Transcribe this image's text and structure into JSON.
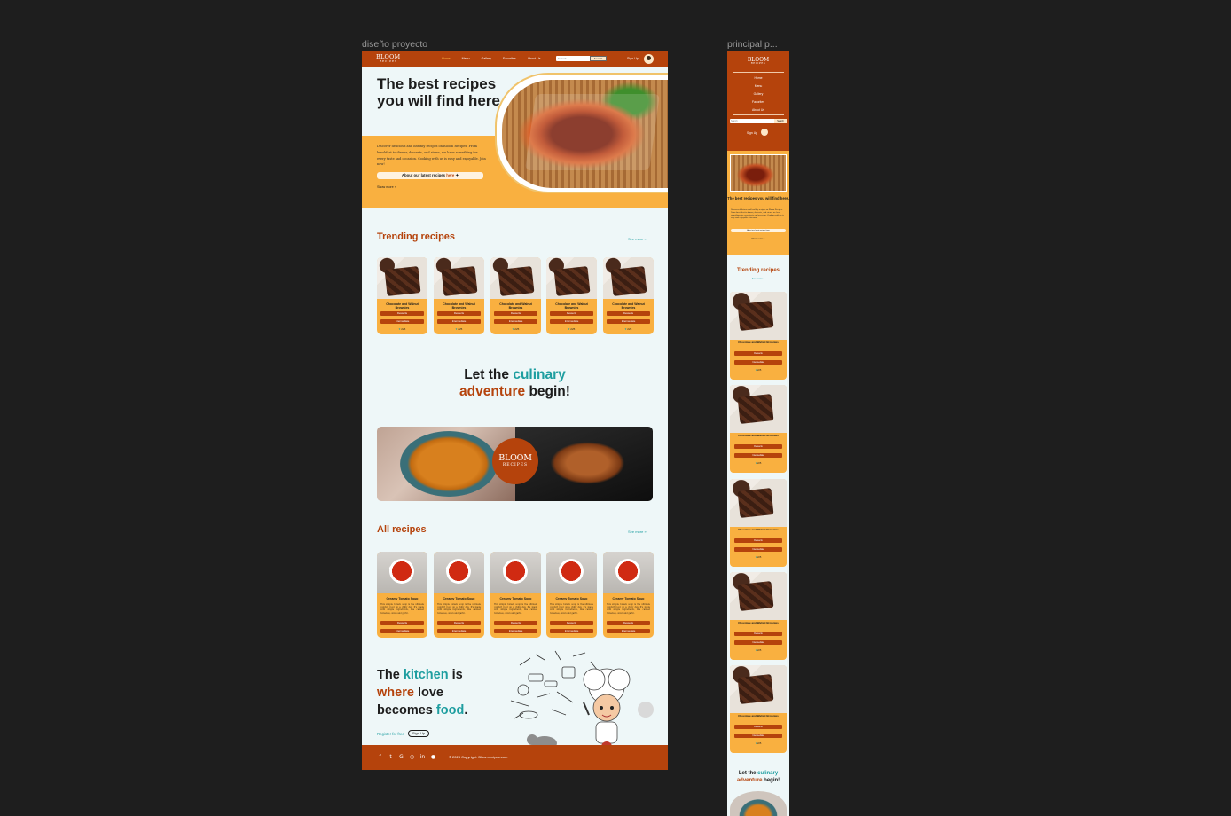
{
  "frames": {
    "desktop_label": "diseño proyecto",
    "mobile_label": "principal p..."
  },
  "colors": {
    "brand_rust": "#b5430c",
    "brand_orange": "#f9b040",
    "accent_teal": "#1e9ea0",
    "page_bg": "#eef7f8",
    "canvas_bg": "#1e1e1e"
  },
  "nav": {
    "logo_main": "BLOOM",
    "logo_sub": "RECIPES",
    "links": [
      "Home",
      "Menu",
      "Gallery",
      "Favorites",
      "About Us"
    ],
    "search_placeholder": "Search",
    "search_button": "Search",
    "sign_up": "Sign Up",
    "avatar_icon": "chef-avatar-icon"
  },
  "hero": {
    "title": "The best recipes you will find here.",
    "description": "Discover delicious and healthy recipes on Bloom Recipes. From breakfast to dinner, desserts, and stews, we have something for every taste and occasion. Cooking with us is easy and enjoyable. Join now!",
    "pill_text": "About our latest recipes",
    "pill_link": "here",
    "show_more": "Show more"
  },
  "trending": {
    "title": "Trending recipes",
    "see_more": "See more",
    "cards": [
      {
        "title": "Chocolate and Walnut Brownies",
        "category": "Desserts",
        "level": "Intermediate",
        "likes": "225"
      },
      {
        "title": "Chocolate and Walnut Brownies",
        "category": "Desserts",
        "level": "Intermediate",
        "likes": "225"
      },
      {
        "title": "Chocolate and Walnut Brownies",
        "category": "Desserts",
        "level": "Intermediate",
        "likes": "225"
      },
      {
        "title": "Chocolate and Walnut Brownies",
        "category": "Desserts",
        "level": "Intermediate",
        "likes": "225"
      },
      {
        "title": "Chocolate and Walnut Brownies",
        "category": "Desserts",
        "level": "Intermediate",
        "likes": "225"
      }
    ]
  },
  "culinary": {
    "part1": "Let the ",
    "part2": "culinary",
    "part3": "adventure",
    "part4": " begin!"
  },
  "banner": {
    "emblem_main": "BLOOM",
    "emblem_sub": "RECIPES"
  },
  "all_recipes": {
    "title": "All recipes",
    "see_more": "See more",
    "cards": [
      {
        "title": "Creamy Tomato Soup",
        "description": "This simple tomato soup is the ultimate comfort food on a chilly day. It's made with simple ingredients, like canned tomatoes, onion and garlic.",
        "category": "Desserts",
        "level": "Intermediate"
      },
      {
        "title": "Creamy Tomato Soup",
        "description": "This simple tomato soup is the ultimate comfort food on a chilly day. It's made with simple ingredients, like canned tomatoes, onion and garlic.",
        "category": "Desserts",
        "level": "Intermediate"
      },
      {
        "title": "Creamy Tomato Soup",
        "description": "This simple tomato soup is the ultimate comfort food on a chilly day. It's made with simple ingredients, like canned tomatoes, onion and garlic.",
        "category": "Desserts",
        "level": "Intermediate"
      },
      {
        "title": "Creamy Tomato Soup",
        "description": "This simple tomato soup is the ultimate comfort food on a chilly day. It's made with simple ingredients, like canned tomatoes, onion and garlic.",
        "category": "Desserts",
        "level": "Intermediate"
      },
      {
        "title": "Creamy Tomato Soup",
        "description": "This simple tomato soup is the ultimate comfort food on a chilly day. It's made with simple ingredients, like canned tomatoes, onion and garlic.",
        "category": "Desserts",
        "level": "Intermediate"
      }
    ]
  },
  "kitchen": {
    "w1": "The ",
    "w2": "kitchen",
    "w3": " is",
    "w4": "where",
    "w5": " love",
    "w6": "becomes ",
    "w7": "food",
    "w8": ".",
    "register_text": "Register for free",
    "sign_up": "Sign Up"
  },
  "footer": {
    "social_icons": [
      "facebook-icon",
      "twitter-icon",
      "google-icon",
      "instagram-icon",
      "linkedin-icon",
      "github-icon"
    ],
    "social_glyphs": [
      "f",
      "t",
      "G",
      "◎",
      "in",
      "●"
    ],
    "copyright": "© 2023 Copyright: Bloomrecipes.com"
  },
  "mobile": {
    "logo_main": "BLOOM",
    "logo_sub": "RECIPES",
    "menu": [
      "Home",
      "Menu",
      "Gallery",
      "Favorites",
      "About Us"
    ],
    "search_placeholder": "Search",
    "search_button": "Search",
    "sign_up": "Sign Up",
    "hero_title": "The best recipes you will find here.",
    "hero_description": "Discover delicious and healthy recipes on Bloom Recipes. From breakfast to dinner, desserts, and stews, we have something for every taste and occasion. Cooking with us is easy and enjoyable. Join now!",
    "pill_text": "About our latest recipes here",
    "show_more": "Show more",
    "trending_title": "Trending recipes",
    "see_more": "See more",
    "cards": [
      {
        "title": "Chocolate and Walnut Brownies",
        "category": "Desserts",
        "level": "Intermediate",
        "likes": "225"
      },
      {
        "title": "Chocolate and Walnut Brownies",
        "category": "Desserts",
        "level": "Intermediate",
        "likes": "225"
      },
      {
        "title": "Chocolate and Walnut Brownies",
        "category": "Desserts",
        "level": "Intermediate",
        "likes": "225"
      },
      {
        "title": "Chocolate and Walnut Brownies",
        "category": "Desserts",
        "level": "Intermediate",
        "likes": "225"
      },
      {
        "title": "Chocolate and Walnut Brownies",
        "category": "Desserts",
        "level": "Intermediate",
        "likes": "225"
      }
    ],
    "culinary_part1": "Let the ",
    "culinary_part2": "culinary",
    "culinary_part3": "adventure",
    "culinary_part4": " begin!"
  }
}
